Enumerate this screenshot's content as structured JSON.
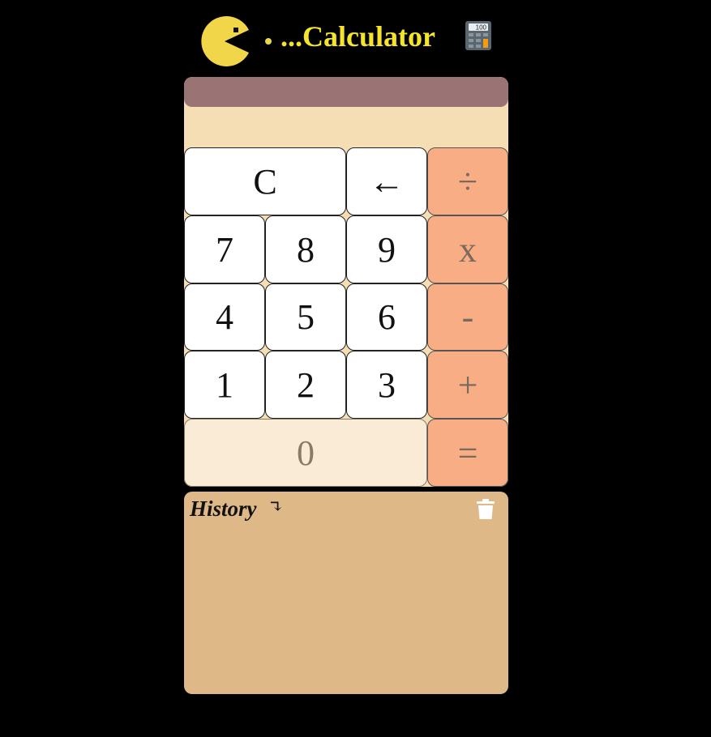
{
  "header": {
    "title": "...Calculator",
    "pacman_icon": "pacman-icon",
    "calculator_icon": "abacus-calculator-icon",
    "calculator_icon_text": "100"
  },
  "display": {
    "value": ""
  },
  "keys": {
    "clear": "C",
    "backspace": "←",
    "divide": "÷",
    "seven": "7",
    "eight": "8",
    "nine": "9",
    "multiply": "x",
    "four": "4",
    "five": "5",
    "six": "6",
    "subtract": "-",
    "one": "1",
    "two": "2",
    "three": "3",
    "add": "+",
    "zero": "0",
    "equals": "="
  },
  "history": {
    "title": "History",
    "arrow": "↴",
    "trash_icon": "trash-icon"
  },
  "colors": {
    "background": "#000000",
    "title": "#f5e42a",
    "pacman": "#f2d64a",
    "calc_body": "#f5deb3",
    "display_bar": "#9a7474",
    "operator_key": "#f9ad85",
    "number_key": "#ffffff",
    "zero_key": "#faebd7",
    "history_panel": "#deb887"
  }
}
